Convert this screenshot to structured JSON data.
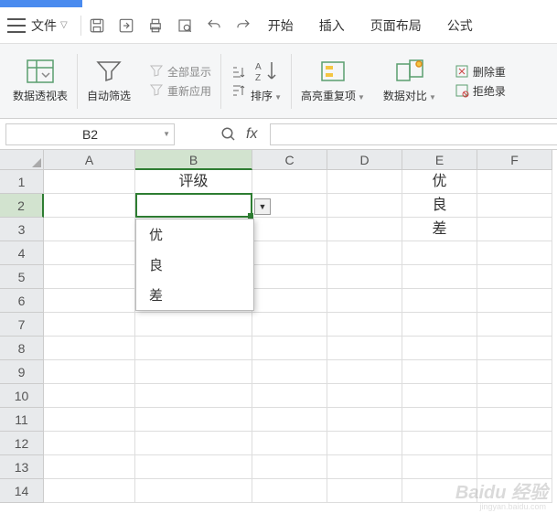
{
  "menubar": {
    "file_label": "文件",
    "tabs": [
      "开始",
      "插入",
      "页面布局",
      "公式"
    ]
  },
  "ribbon": {
    "pivot": "数据透视表",
    "autofilter": "自动筛选",
    "show_all": "全部显示",
    "reapply": "重新应用",
    "sort": "排序",
    "highlight_dup": "高亮重复项",
    "data_compare": "数据对比",
    "del_dup": "删除重",
    "reject_rec": "拒绝录"
  },
  "namebox": {
    "ref": "B2"
  },
  "columns": [
    "A",
    "B",
    "C",
    "D",
    "E",
    "F"
  ],
  "rows": [
    "1",
    "2",
    "3",
    "4",
    "5",
    "6",
    "7",
    "8",
    "9",
    "10",
    "11",
    "12",
    "13",
    "14"
  ],
  "cells": {
    "B1": "评级",
    "E1": "优",
    "E2": "良",
    "E3": "差"
  },
  "dropdown": {
    "items": [
      "优",
      "良",
      "差"
    ]
  },
  "watermark": {
    "main": "Baidu 经验",
    "sub": "jingyan.baidu.com"
  }
}
